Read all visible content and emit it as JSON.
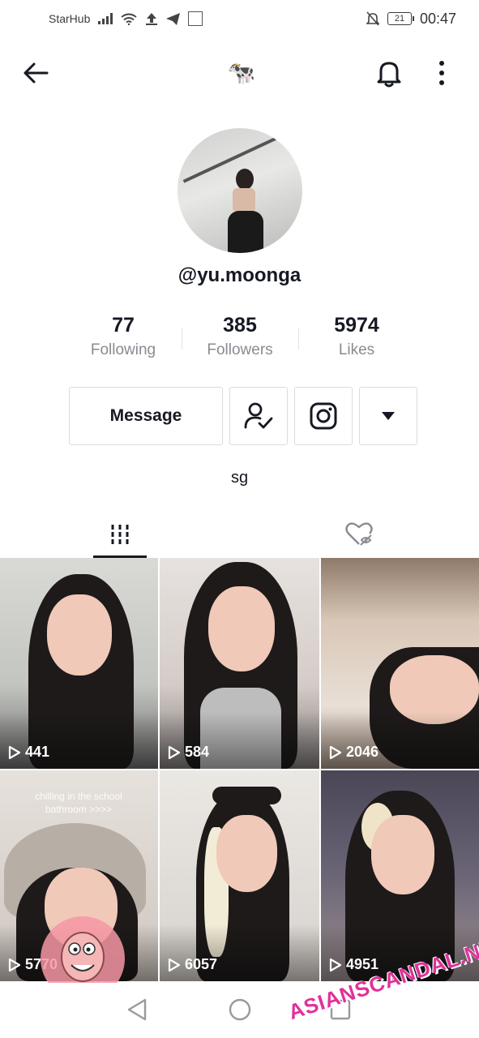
{
  "status_bar": {
    "carrier": "StarHub",
    "battery": "21",
    "time": "00:47"
  },
  "nav": {
    "title_emoji": "🐄",
    "back_icon": "arrow-left-icon",
    "bell_icon": "bell-icon",
    "more_icon": "more-vertical-icon"
  },
  "profile": {
    "username": "@yu.moonga",
    "bio": "sg"
  },
  "stats": [
    {
      "value": "77",
      "label": "Following"
    },
    {
      "value": "385",
      "label": "Followers"
    },
    {
      "value": "5974",
      "label": "Likes"
    }
  ],
  "actions": {
    "message_label": "Message",
    "follow_icon": "user-check-icon",
    "instagram_icon": "instagram-icon",
    "dropdown_icon": "triangle-down-icon"
  },
  "tabs": [
    {
      "icon": "grid-icon",
      "active": true
    },
    {
      "icon": "liked-private-icon",
      "active": false
    }
  ],
  "videos": [
    {
      "views": "441"
    },
    {
      "views": "584"
    },
    {
      "views": "2046"
    },
    {
      "views": "5770",
      "caption": "chilling in the school bathroom >>>>"
    },
    {
      "views": "6057"
    },
    {
      "views": "4951"
    }
  ],
  "watermark": "ASIANSCANDAL.NET",
  "colors": {
    "text_primary": "#161823",
    "text_secondary": "#8a8b91",
    "border": "#dcdcdd"
  }
}
